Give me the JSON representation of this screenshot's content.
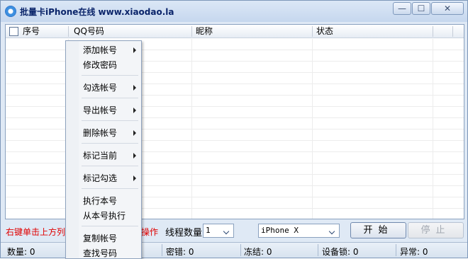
{
  "window": {
    "title": "批量卡iPhone在线 www.xiaodao.la",
    "minimize": "—",
    "maximize": "☐",
    "close": "✕"
  },
  "table": {
    "columns": [
      "序号",
      "QQ号码",
      "昵称",
      "状态"
    ]
  },
  "context_menu": {
    "items": [
      {
        "label": "添加帐号",
        "submenu": true
      },
      {
        "label": "修改密码",
        "submenu": false
      },
      {
        "label": "勾选帐号",
        "submenu": true
      },
      {
        "label": "导出帐号",
        "submenu": true
      },
      {
        "label": "删除帐号",
        "submenu": true
      },
      {
        "label": "标记当前",
        "submenu": true
      },
      {
        "label": "标记勾选",
        "submenu": true
      },
      {
        "label": "执行本号",
        "submenu": false
      },
      {
        "label": "从本号执行",
        "submenu": false
      },
      {
        "label": "复制帐号",
        "submenu": false
      },
      {
        "label": "查找号码",
        "submenu": false
      }
    ]
  },
  "controls": {
    "hint_left": "右键单击上方列",
    "hint_right": "操作",
    "thread_label": "线程数量",
    "thread_value": "1",
    "device_value": "iPhone X",
    "start_label": "开始",
    "stop_label": "停止"
  },
  "status": {
    "count": "数量: 0",
    "pwd_error": "密错: 0",
    "frozen": "冻结: 0",
    "device_lock": "设备锁: 0",
    "abnormal": "异常: 0"
  }
}
